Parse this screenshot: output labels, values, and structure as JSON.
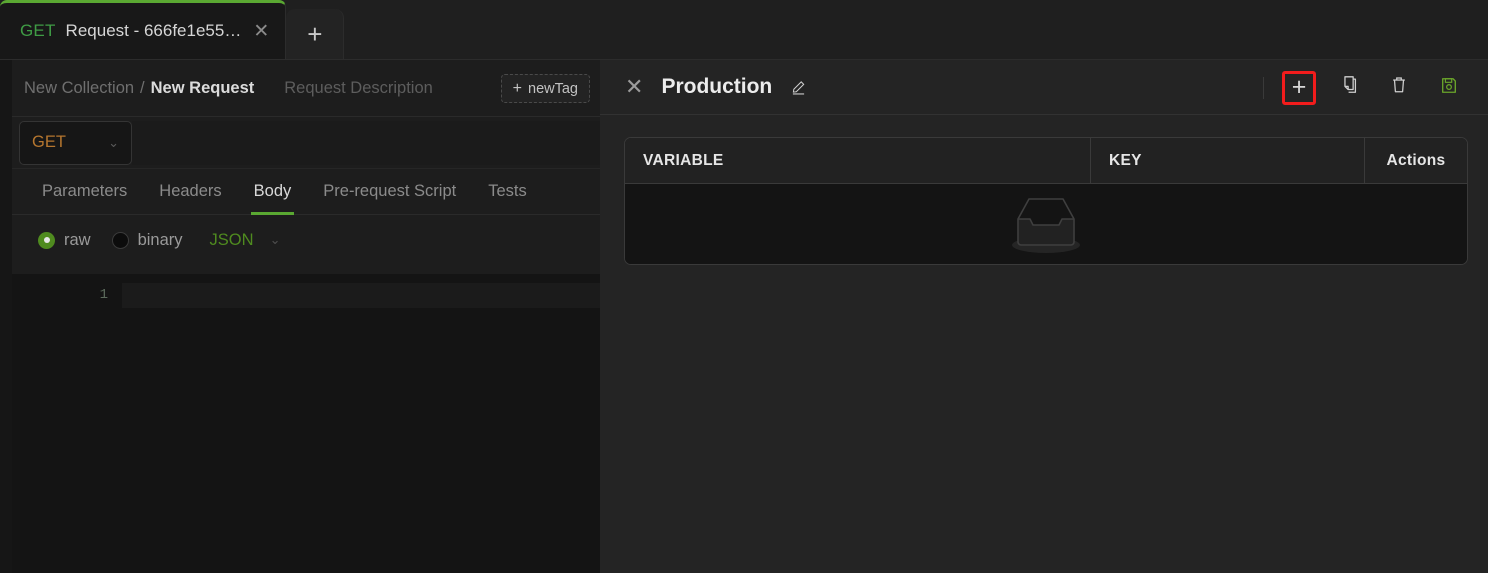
{
  "tabbar": {
    "tabs": [
      {
        "method": "GET",
        "title": "Request - 666fe1e55…",
        "close_label": "✕"
      }
    ],
    "add_tab_label": "+"
  },
  "request": {
    "breadcrumb": {
      "collection": "New Collection",
      "separator": "/",
      "request": "New Request",
      "description": "Request Description"
    },
    "new_tag": {
      "plus": "+",
      "label": "newTag"
    },
    "method": {
      "value": "GET",
      "chevron": "⌄",
      "color": "#b5762f"
    },
    "url": {
      "value": "",
      "placeholder": ""
    },
    "tabs": [
      {
        "label": "Parameters",
        "active": false
      },
      {
        "label": "Headers",
        "active": false
      },
      {
        "label": "Body",
        "active": true
      },
      {
        "label": "Pre-request Script",
        "active": false
      },
      {
        "label": "Tests",
        "active": false
      }
    ],
    "body_options": {
      "raw": {
        "label": "raw",
        "selected": true
      },
      "binary": {
        "label": "binary",
        "selected": false
      },
      "content_type": {
        "label": "JSON",
        "chevron": "⌄",
        "color": "#4f8b1f"
      }
    },
    "editor": {
      "line_numbers": [
        "1"
      ],
      "content": ""
    }
  },
  "environment": {
    "close_icon": "✕",
    "title": "Production",
    "edit_icon": "pencil-icon",
    "actions": [
      {
        "name": "add-variable",
        "icon": "plus-icon",
        "label": "+",
        "highlighted": true,
        "highlight_color": "#f21c1c"
      },
      {
        "name": "duplicate-environment",
        "icon": "copy-icon",
        "label": "",
        "highlighted": false
      },
      {
        "name": "delete-environment",
        "icon": "trash-icon",
        "label": "",
        "highlighted": false
      },
      {
        "name": "save-environment",
        "icon": "save-disk-icon",
        "label": "",
        "highlighted": false,
        "color": "#6aa52a"
      }
    ],
    "table": {
      "columns": [
        "VARIABLE",
        "KEY",
        "Actions"
      ],
      "rows": [],
      "empty_icon": "inbox-icon"
    }
  }
}
